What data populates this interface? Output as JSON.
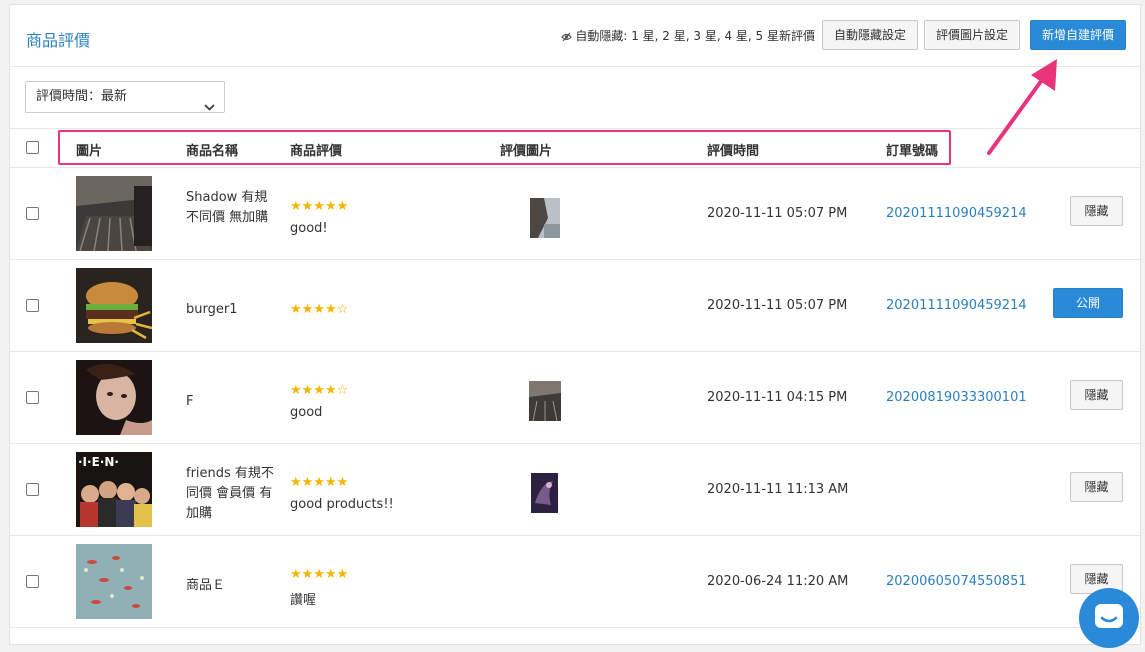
{
  "header": {
    "title": "商品評價",
    "auto_hide_text": "自動隱藏: 1 星, 2 星, 3 星, 4 星, 5 星新評價",
    "btn_auto_hide_settings": "自動隱藏設定",
    "btn_review_image_settings": "評價圖片設定",
    "btn_new_review": "新增自建評價"
  },
  "filter": {
    "label": "評價時間：最新"
  },
  "columns": {
    "image": "圖片",
    "product_name": "商品名稱",
    "rating": "商品評價",
    "review_image": "評價圖片",
    "review_time": "評價時間",
    "order_no": "訂單號碼"
  },
  "rows": [
    {
      "name": "Shadow 有規不同價 無加購",
      "stars": 5,
      "stars_text": "★★★★★",
      "comment": "good!",
      "has_review_image": true,
      "time": "2020-11-11 05:07 PM",
      "order": "20201111090459214",
      "action": "隱藏",
      "action_type": "hide"
    },
    {
      "name": "burger1",
      "stars": 4,
      "stars_text": "★★★★☆",
      "comment": "",
      "has_review_image": false,
      "time": "2020-11-11 05:07 PM",
      "order": "20201111090459214",
      "action": "公開",
      "action_type": "public"
    },
    {
      "name": "F",
      "stars": 4,
      "stars_text": "★★★★☆",
      "comment": "good",
      "has_review_image": true,
      "time": "2020-11-11 04:15 PM",
      "order": "20200819033300101",
      "action": "隱藏",
      "action_type": "hide"
    },
    {
      "name": "friends 有規不同價 會員價 有加購",
      "stars": 5,
      "stars_text": "★★★★★",
      "comment": "good products!!",
      "has_review_image": true,
      "time": "2020-11-11 11:13 AM",
      "order": "",
      "action": "隱藏",
      "action_type": "hide"
    },
    {
      "name": "商品Ｅ",
      "stars": 5,
      "stars_text": "★★★★★",
      "comment": "讚喔",
      "has_review_image": false,
      "time": "2020-06-24 11:20 AM",
      "order": "20200605074550851",
      "action": "隱藏",
      "action_type": "hide"
    }
  ],
  "colors": {
    "accent": "#2a8ad8",
    "link": "#2a7fc0",
    "star": "#f4b400",
    "highlight": "#e8347a"
  }
}
